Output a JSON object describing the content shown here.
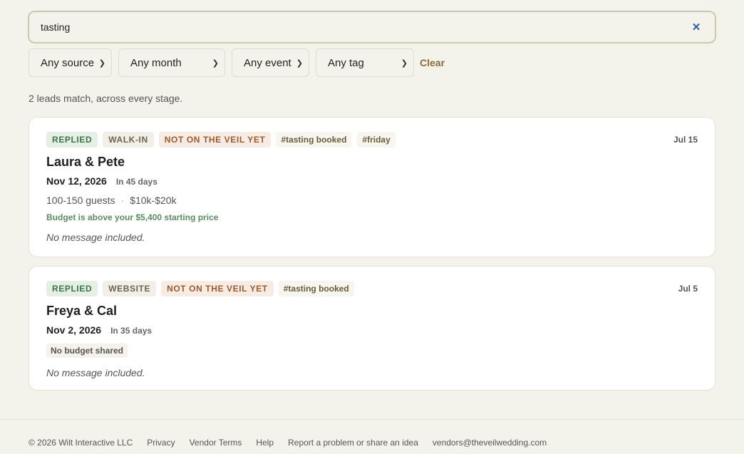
{
  "search": {
    "value": "tasting",
    "clear_icon": "close-icon"
  },
  "filters": {
    "source": "Any source",
    "month": "Any month",
    "event": "Any event",
    "tag": "Any tag",
    "clear_label": "Clear"
  },
  "summary": "2 leads match, across every stage.",
  "leads": [
    {
      "tags": [
        "REPLIED",
        "WALK-IN",
        "NOT ON THE VEIL YET"
      ],
      "hashtags": [
        "#tasting booked",
        "#friday"
      ],
      "received": "Jul 15",
      "name": "Laura & Pete",
      "event_date": "Nov 12, 2026",
      "event_relative": "In 45 days",
      "guests": "100-150 guests",
      "budget": "$10k-$20k",
      "budget_note": "Budget is above your $5,400 starting price",
      "message": "No message included."
    },
    {
      "tags": [
        "REPLIED",
        "WEBSITE",
        "NOT ON THE VEIL YET"
      ],
      "hashtags": [
        "#tasting booked"
      ],
      "received": "Jul 5",
      "name": "Freya & Cal",
      "event_date": "Nov 2, 2026",
      "event_relative": "In 35 days",
      "budget_badge": "No budget shared",
      "message": "No message included."
    }
  ],
  "footer": {
    "copyright": "© 2026 Wilt Interactive LLC",
    "privacy": "Privacy",
    "terms": "Vendor Terms",
    "help": "Help",
    "report": "Report a problem or share an idea",
    "email": "vendors@theveilwedding.com"
  },
  "colors": {
    "accent": "#8b6a3a",
    "replied": "#3e7448",
    "veil": "#9a5a2d",
    "clear_icon": "#2f5f9a"
  }
}
